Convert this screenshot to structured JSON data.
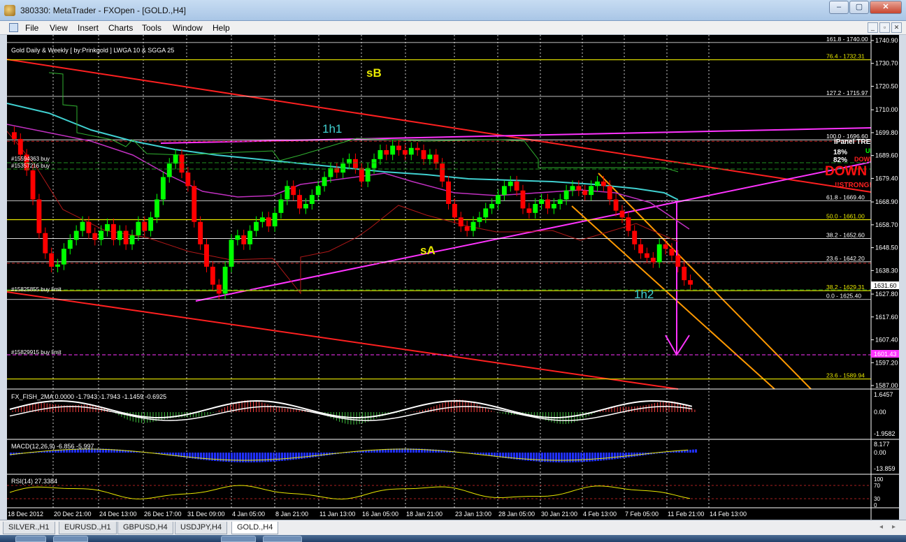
{
  "window": {
    "title": "380330: MetaTrader - FXOpen - [GOLD.,H4]",
    "buttons": [
      "–",
      "▢",
      "✕"
    ]
  },
  "menu": [
    "File",
    "View",
    "Insert",
    "Charts",
    "Tools",
    "Window",
    "Help"
  ],
  "mdi_controls": [
    "_",
    "▫",
    "✕"
  ],
  "chart": {
    "header": "Gold Daily & Weekly [ by:Prinkgold ] LWGA 10  &  SGGA 25",
    "price_axis": [
      "1740.90",
      "1730.70",
      "1720.50",
      "1710.00",
      "1699.80",
      "1689.60",
      "1679.40",
      "1668.90",
      "1658.70",
      "1648.50",
      "1638.30",
      "1627.80",
      "1617.60",
      "1607.40",
      "1597.20",
      "1587.00"
    ],
    "current_price": "1631.60",
    "pending_price": "1601.43",
    "time_axis": [
      "18 Dec 2012",
      "20 Dec 21:00",
      "24 Dec 13:00",
      "26 Dec 17:00",
      "31 Dec 09:00",
      "4 Jan 05:00",
      "8 Jan 21:00",
      "11 Jan 13:00",
      "16 Jan 05:00",
      "18 Jan 21:00",
      "23 Jan 13:00",
      "28 Jan 05:00",
      "30 Jan 21:00",
      "4 Feb 13:00",
      "7 Feb 05:00",
      "11 Feb 21:00",
      "14 Feb 13:00"
    ],
    "fib_levels": [
      "161.8 - 1740.00",
      "76.4 - 1732.31",
      "127.2 - 1715.97",
      "100.0 - 1696.60",
      "61.8 - 1669.40",
      "50.0 - 1661.00",
      "38.2 - 1652.60",
      "23.6 - 1642.20",
      "38.2 - 1629.31",
      "0.0 - 1625.40",
      "23.6 - 1589.94"
    ],
    "labels": [
      "sB",
      "1h1",
      "sA",
      "1h2"
    ],
    "orders": [
      "#15594363 buy",
      "#15357216 buy",
      "#15825855 buy limit",
      "#15829915 buy limit"
    ],
    "trend_panel": {
      "title": "iPanel TREND",
      "lines": [
        "UP",
        "18%",
        "82%",
        "DOWN"
      ],
      "big": "DOWN",
      "strong": "!!STRONG!!"
    }
  },
  "fisher": {
    "label": "FX_FISH_2MA 0.0000 -1.7943 -1.7943 -1.1459 -0.6925",
    "axis": [
      "1.6457",
      "0.00",
      "-1.9582"
    ]
  },
  "macd": {
    "label": "MACD(12,26,9) -6.856 -5.997",
    "axis": [
      "8.177",
      "0.00",
      "-13.859"
    ]
  },
  "rsi": {
    "label": "RSI(14) 27.3384",
    "axis": [
      "100",
      "70",
      "30",
      "0"
    ]
  },
  "tabs": [
    "SILVER.,H1",
    "EURUSD.,H1",
    "GBPUSD,H4",
    "USDJPY,H4",
    "GOLD.,H4"
  ],
  "active_tab": "GOLD.,H4",
  "tab_nav": [
    "◂",
    "▸"
  ],
  "colors": {
    "bull": "#00ff00",
    "bear": "#ff0000",
    "grid": "#ffffff",
    "background": "#000000",
    "channel": "#ff2020",
    "magenta": "#ff33ff",
    "orange": "#ff9900"
  }
}
